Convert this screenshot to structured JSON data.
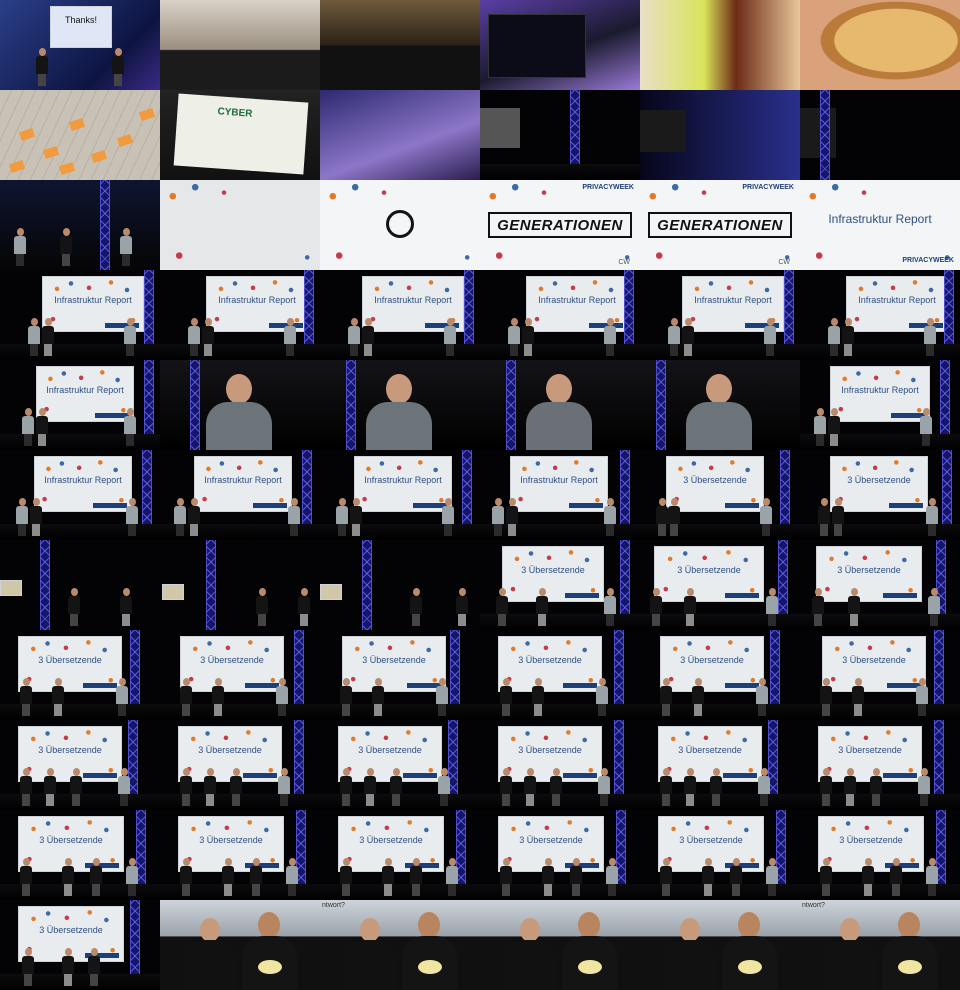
{
  "grid": {
    "columns": 6,
    "rows": 11
  },
  "slide_texts": {
    "infrastruktur_report": "Infrastruktur Report",
    "uebersetzende": "3 Übersetzende",
    "generationen": "GENERATIONEN",
    "privacyweek": "PRIVACYWEEK",
    "thanks": "Thanks!",
    "cw": "CW",
    "antwort_fragment": "ntwort?",
    "cyber_fragment": "CYBER"
  },
  "row_descriptions": [
    "misc event photos: talk stage, audience, mixing desk, food",
    "sticky notes, graphic recording, stage speakers",
    "speaker with audience, PrivacyWeek title slides",
    "two speakers in front of Infrastruktur Report slide",
    "Infrastruktur Report and speaker closeups",
    "Infrastruktur Report and 3 Übersetzende slides",
    "two performers on dark stage, 3 Übersetzende",
    "3 Übersetzende performers on stage",
    "3 Übersetzende performers on stage",
    "3 Übersetzende performers on stage",
    "3 Übersetzende stage and closeups of performers"
  ]
}
